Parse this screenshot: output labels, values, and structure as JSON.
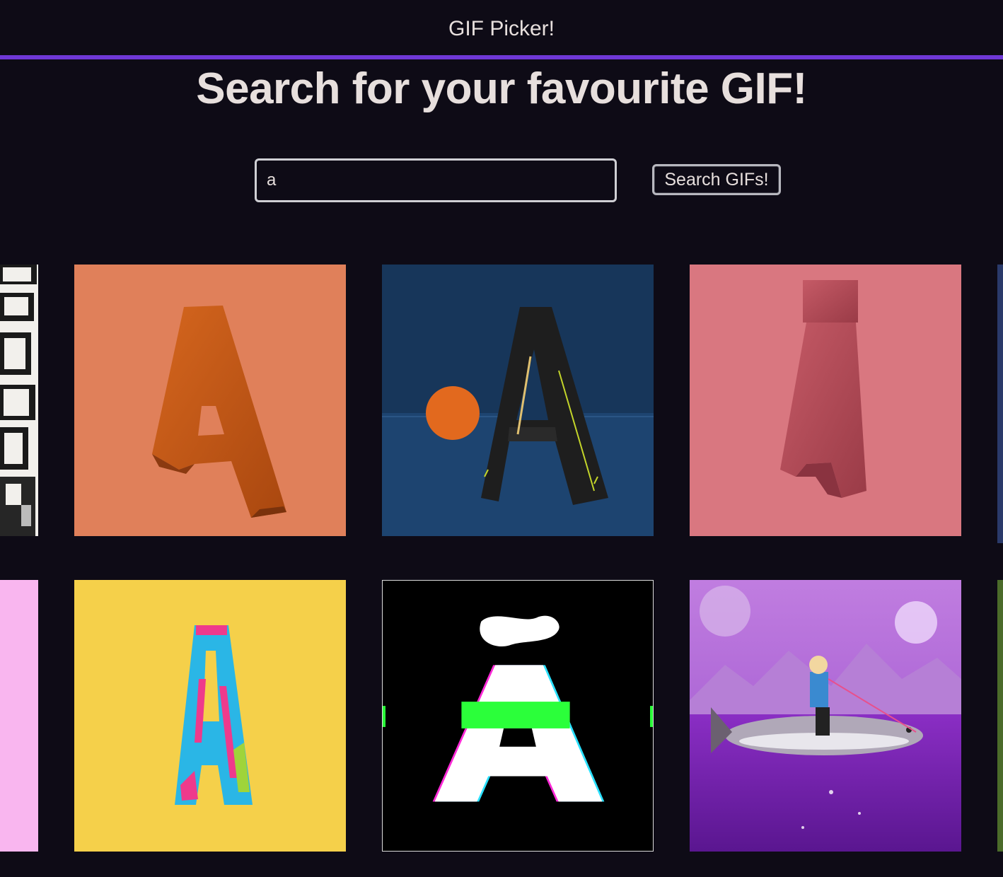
{
  "header": {
    "title": "GIF Picker!",
    "accent_color": "#6f38d6",
    "background_color": "#0e0b16"
  },
  "main": {
    "heading": "Search for your favourite GIF!",
    "search": {
      "value": "a",
      "placeholder": ""
    },
    "search_button_label": "Search GIFs!"
  },
  "results": {
    "gifs": [
      {
        "subject": "partial black and white abstract shapes",
        "background": "#f2f0ec"
      },
      {
        "subject": "furry orange letter A",
        "background": "#e0805a"
      },
      {
        "subject": "black sneaker-texture letter A with orange ball",
        "background": "#17365a"
      },
      {
        "subject": "furry pink letter A",
        "background": "#d97780"
      },
      {
        "subject": "partial dark blue tile",
        "background": "#2a3a6a"
      },
      {
        "subject": "partial pink tile",
        "background": "#f9b6ef"
      },
      {
        "subject": "colorful letter A on yellow",
        "background": "#f5d04a"
      },
      {
        "subject": "glitch letter A with tilde on black",
        "background": "#000000"
      },
      {
        "subject": "person riding a fish on purple sea",
        "background": "#9a38c9"
      },
      {
        "subject": "partial green tile",
        "background": "#4b6b2a"
      }
    ]
  }
}
